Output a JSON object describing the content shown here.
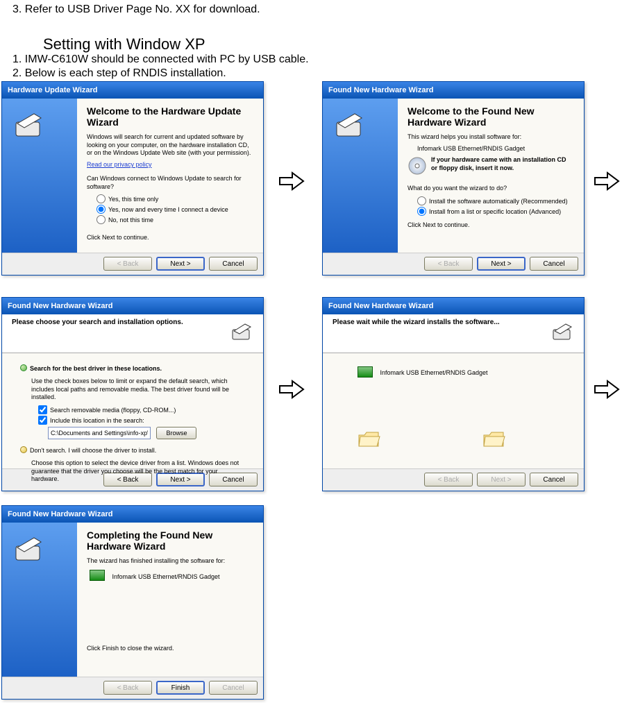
{
  "doc": {
    "line3": "3. Refer to USB Driver Page No. XX for download.",
    "heading": "Setting with Window XP",
    "line1": "1. IMW-C610W should be connected with PC by USB cable.",
    "line2": "2. Below is each step of RNDIS installation."
  },
  "wiz1": {
    "title": "Hardware Update Wizard",
    "heading": "Welcome to the Hardware Update Wizard",
    "body1": "Windows will search for current and updated software by looking on your computer, on the hardware installation CD, or on the Windows Update Web site (with your permission).",
    "privacy": "Read our privacy policy",
    "body2": "Can Windows connect to Windows Update to search for software?",
    "opt1": "Yes, this time only",
    "opt2": "Yes, now and every time I connect a device",
    "opt3": "No, not this time",
    "footer": "Click Next to continue.",
    "back": "< Back",
    "next": "Next >",
    "cancel": "Cancel"
  },
  "wiz2": {
    "title": "Found New Hardware Wizard",
    "heading": "Welcome to the Found New Hardware Wizard",
    "body1": "This wizard helps you install software for:",
    "device": "Infomark USB Ethernet/RNDIS Gadget",
    "cdnote": "If your hardware came with an installation CD or floppy disk, insert it now.",
    "body2": "What do you want the wizard to do?",
    "opt1": "Install the software automatically (Recommended)",
    "opt2": "Install from a list or specific location (Advanced)",
    "footer": "Click Next to continue.",
    "back": "< Back",
    "next": "Next >",
    "cancel": "Cancel"
  },
  "wiz3": {
    "title": "Found New Hardware Wizard",
    "heading": "Please choose your search and installation options.",
    "opt1label": "Search for the best driver in these locations.",
    "opt1text": "Use the check boxes below to limit or expand the default search, which includes local paths and removable media. The best driver found will be installed.",
    "chk1": "Search removable media (floppy, CD-ROM...)",
    "chk2": "Include this location in the search:",
    "path": "C:\\Documents and Settings\\info-xp\\Desktop",
    "browse": "Browse",
    "opt2label": "Don't search. I will choose the driver to install.",
    "opt2text": "Choose this option to select the device driver from a list. Windows does not guarantee that the driver you choose will be the best match for your hardware.",
    "back": "< Back",
    "next": "Next >",
    "cancel": "Cancel"
  },
  "wiz4": {
    "title": "Found New Hardware Wizard",
    "heading": "Please wait while the wizard installs the software...",
    "device": "Infomark USB Ethernet/RNDIS Gadget",
    "back": "< Back",
    "next": "Next >",
    "cancel": "Cancel"
  },
  "wiz5": {
    "title": "Found New Hardware Wizard",
    "heading": "Completing the Found New Hardware Wizard",
    "body1": "The wizard has finished installing the software for:",
    "device": "Infomark USB Ethernet/RNDIS Gadget",
    "footer": "Click Finish to close the wizard.",
    "back": "< Back",
    "finish": "Finish",
    "cancel": "Cancel"
  }
}
